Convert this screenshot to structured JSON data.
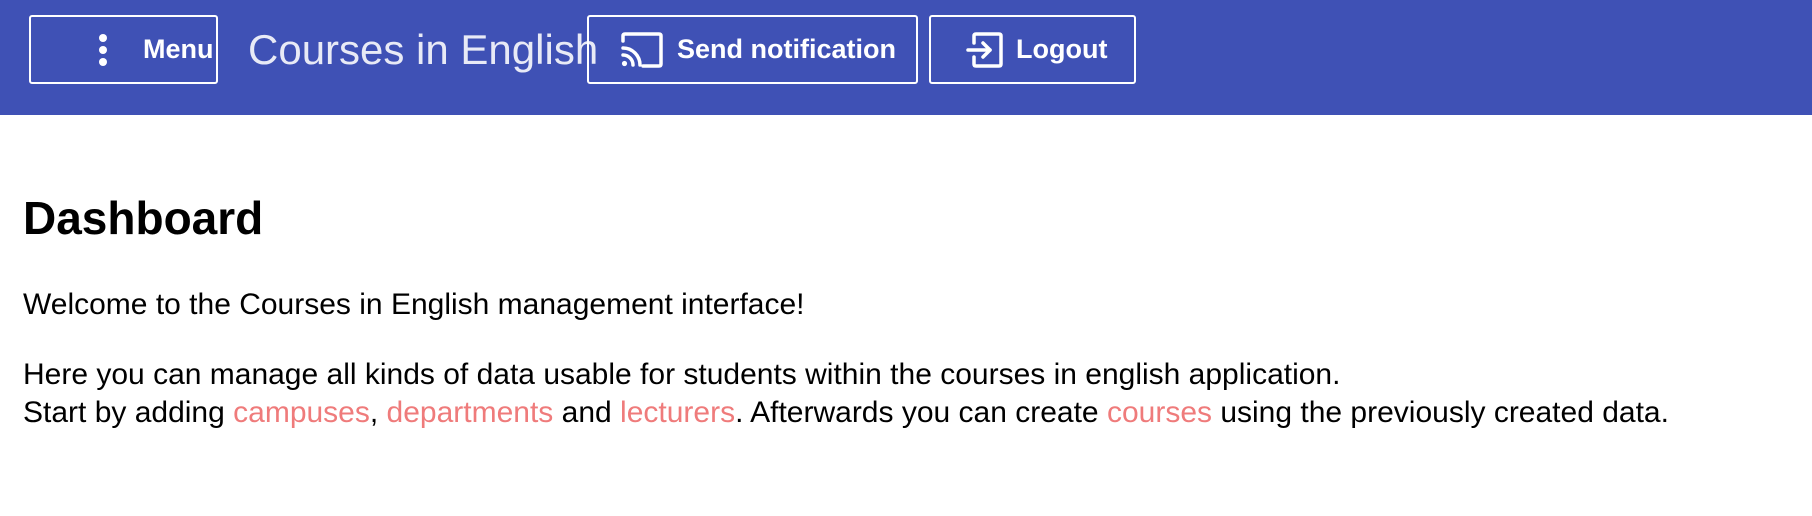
{
  "header": {
    "menu_label": "Menu",
    "menu_icon": "more-vert-icon",
    "title": "Courses in English",
    "notify_label": "Send notification",
    "notify_icon": "cast-icon",
    "logout_label": "Logout",
    "logout_icon": "logout-icon",
    "background_color": "#3f51b5"
  },
  "main": {
    "heading": "Dashboard",
    "welcome": "Welcome to the Courses in English management interface!",
    "intro": "Here you can manage all kinds of data usable for students within the courses in english application.",
    "start": {
      "prefix": "Start by adding ",
      "link_campuses": "campuses",
      "sep1": ", ",
      "link_departments": "departments",
      "sep2": " and ",
      "link_lecturers": "lecturers",
      "middle": ". Afterwards you can create ",
      "link_courses": "courses",
      "suffix": " using the previously created data."
    },
    "link_color": "#ef7b7b"
  }
}
